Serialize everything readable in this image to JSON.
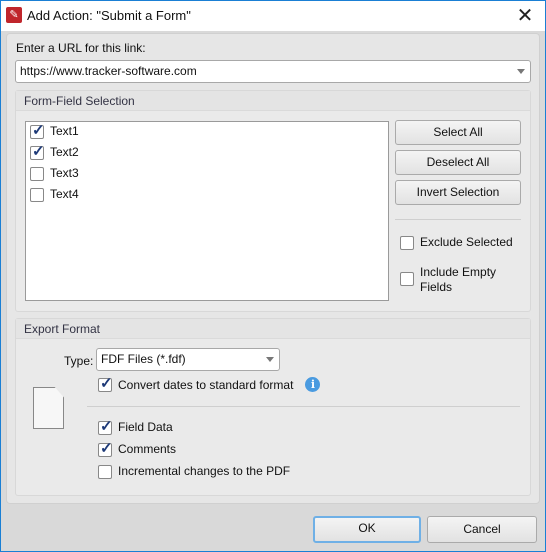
{
  "window": {
    "title": "Add Action: \"Submit a Form\"",
    "close": "✕",
    "app_icon": "pdf-xchange-icon"
  },
  "url": {
    "label": "Enter a URL for this link:",
    "value": "https://www.tracker-software.com"
  },
  "form_fields": {
    "header": "Form-Field Selection",
    "items": [
      {
        "label": "Text1",
        "checked": true
      },
      {
        "label": "Text2",
        "checked": true
      },
      {
        "label": "Text3",
        "checked": false
      },
      {
        "label": "Text4",
        "checked": false
      }
    ],
    "select_all": "Select All",
    "deselect_all": "Deselect All",
    "invert": "Invert Selection",
    "exclude_selected": {
      "label": "Exclude Selected",
      "checked": false
    },
    "include_empty": {
      "label": "Include Empty Fields",
      "checked": false
    }
  },
  "export": {
    "header": "Export Format",
    "type_label": "Type:",
    "type_value": "FDF Files (*.fdf)",
    "convert_dates": {
      "label": "Convert dates to standard format",
      "checked": true
    },
    "field_data": {
      "label": "Field Data",
      "checked": true
    },
    "comments": {
      "label": "Comments",
      "checked": true
    },
    "incremental": {
      "label": "Incremental changes to the PDF",
      "checked": false
    }
  },
  "buttons": {
    "ok": "OK",
    "cancel": "Cancel"
  },
  "colors": {
    "accent": "#1a7fd4",
    "info": "#4a9be0"
  }
}
